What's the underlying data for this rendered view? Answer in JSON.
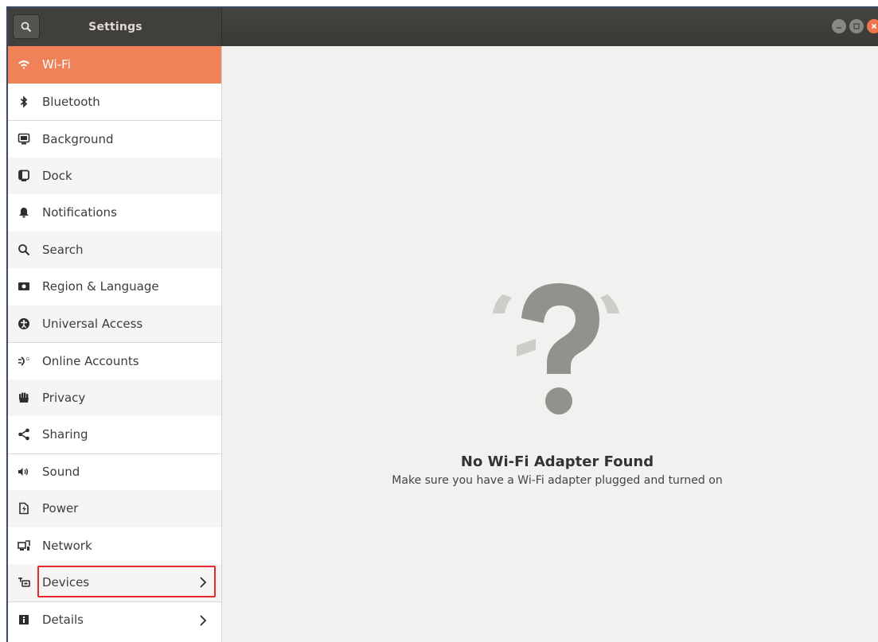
{
  "window": {
    "title": "Settings"
  },
  "sidebar": {
    "items": [
      {
        "label": "Wi-Fi",
        "icon": "wifi-icon"
      },
      {
        "label": "Bluetooth",
        "icon": "bluetooth-icon"
      },
      {
        "label": "Background",
        "icon": "background-icon"
      },
      {
        "label": "Dock",
        "icon": "dock-icon"
      },
      {
        "label": "Notifications",
        "icon": "bell-icon"
      },
      {
        "label": "Search",
        "icon": "search-icon"
      },
      {
        "label": "Region & Language",
        "icon": "region-icon"
      },
      {
        "label": "Universal Access",
        "icon": "accessibility-icon"
      },
      {
        "label": "Online Accounts",
        "icon": "online-accounts-icon"
      },
      {
        "label": "Privacy",
        "icon": "hand-icon"
      },
      {
        "label": "Sharing",
        "icon": "share-icon"
      },
      {
        "label": "Sound",
        "icon": "speaker-icon"
      },
      {
        "label": "Power",
        "icon": "power-icon"
      },
      {
        "label": "Network",
        "icon": "network-icon"
      },
      {
        "label": "Devices",
        "icon": "devices-icon"
      },
      {
        "label": "Details",
        "icon": "details-icon"
      }
    ],
    "active_index": 0,
    "highlighted_index": 14
  },
  "content": {
    "empty_title": "No Wi-Fi Adapter Found",
    "empty_subtitle": "Make sure you have a Wi-Fi adapter plugged and turned on"
  },
  "colors": {
    "accent": "#f0825a",
    "highlight_box": "#e0282e",
    "titlebar": "#3c3b37"
  }
}
